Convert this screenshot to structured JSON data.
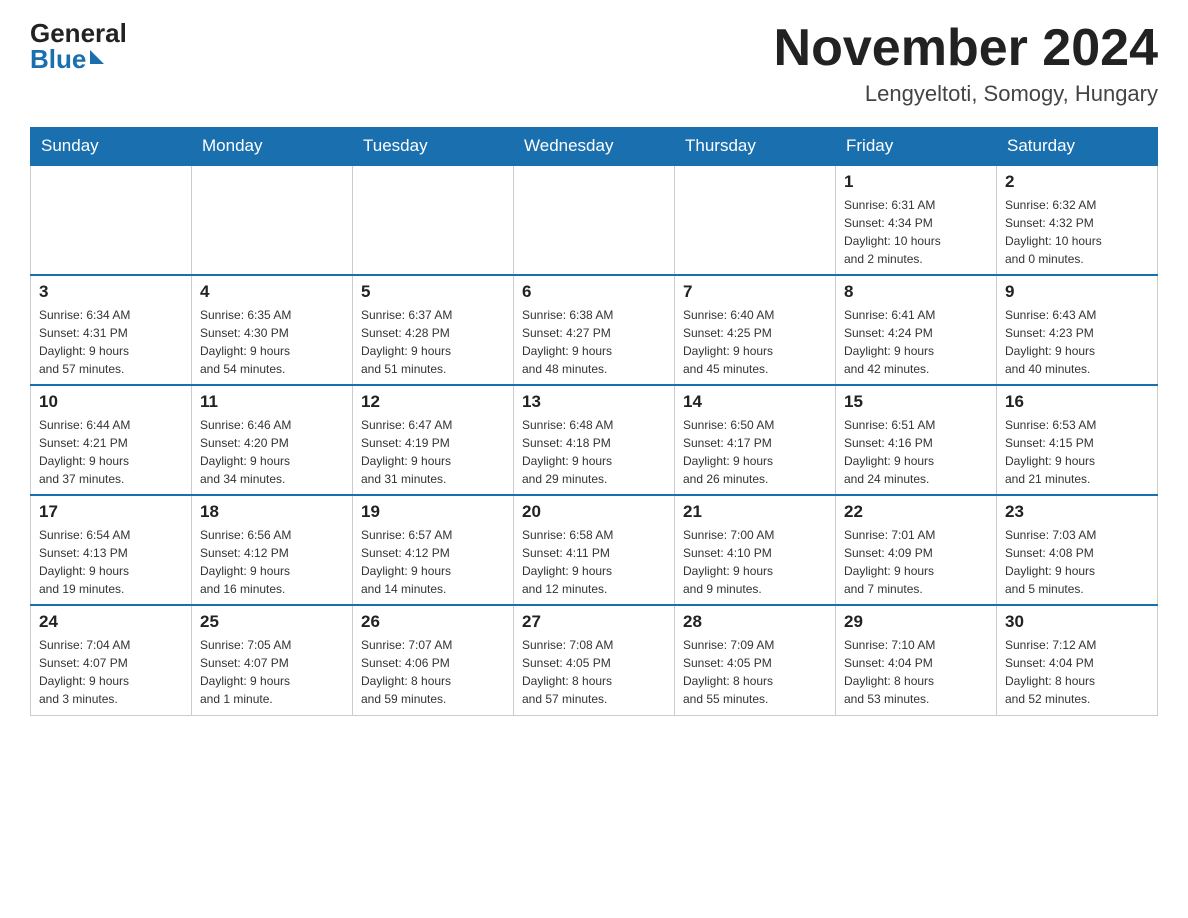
{
  "header": {
    "logo_general": "General",
    "logo_blue": "Blue",
    "month_title": "November 2024",
    "location": "Lengyeltoti, Somogy, Hungary"
  },
  "weekdays": [
    "Sunday",
    "Monday",
    "Tuesday",
    "Wednesday",
    "Thursday",
    "Friday",
    "Saturday"
  ],
  "weeks": [
    [
      {
        "day": "",
        "info": ""
      },
      {
        "day": "",
        "info": ""
      },
      {
        "day": "",
        "info": ""
      },
      {
        "day": "",
        "info": ""
      },
      {
        "day": "",
        "info": ""
      },
      {
        "day": "1",
        "info": "Sunrise: 6:31 AM\nSunset: 4:34 PM\nDaylight: 10 hours\nand 2 minutes."
      },
      {
        "day": "2",
        "info": "Sunrise: 6:32 AM\nSunset: 4:32 PM\nDaylight: 10 hours\nand 0 minutes."
      }
    ],
    [
      {
        "day": "3",
        "info": "Sunrise: 6:34 AM\nSunset: 4:31 PM\nDaylight: 9 hours\nand 57 minutes."
      },
      {
        "day": "4",
        "info": "Sunrise: 6:35 AM\nSunset: 4:30 PM\nDaylight: 9 hours\nand 54 minutes."
      },
      {
        "day": "5",
        "info": "Sunrise: 6:37 AM\nSunset: 4:28 PM\nDaylight: 9 hours\nand 51 minutes."
      },
      {
        "day": "6",
        "info": "Sunrise: 6:38 AM\nSunset: 4:27 PM\nDaylight: 9 hours\nand 48 minutes."
      },
      {
        "day": "7",
        "info": "Sunrise: 6:40 AM\nSunset: 4:25 PM\nDaylight: 9 hours\nand 45 minutes."
      },
      {
        "day": "8",
        "info": "Sunrise: 6:41 AM\nSunset: 4:24 PM\nDaylight: 9 hours\nand 42 minutes."
      },
      {
        "day": "9",
        "info": "Sunrise: 6:43 AM\nSunset: 4:23 PM\nDaylight: 9 hours\nand 40 minutes."
      }
    ],
    [
      {
        "day": "10",
        "info": "Sunrise: 6:44 AM\nSunset: 4:21 PM\nDaylight: 9 hours\nand 37 minutes."
      },
      {
        "day": "11",
        "info": "Sunrise: 6:46 AM\nSunset: 4:20 PM\nDaylight: 9 hours\nand 34 minutes."
      },
      {
        "day": "12",
        "info": "Sunrise: 6:47 AM\nSunset: 4:19 PM\nDaylight: 9 hours\nand 31 minutes."
      },
      {
        "day": "13",
        "info": "Sunrise: 6:48 AM\nSunset: 4:18 PM\nDaylight: 9 hours\nand 29 minutes."
      },
      {
        "day": "14",
        "info": "Sunrise: 6:50 AM\nSunset: 4:17 PM\nDaylight: 9 hours\nand 26 minutes."
      },
      {
        "day": "15",
        "info": "Sunrise: 6:51 AM\nSunset: 4:16 PM\nDaylight: 9 hours\nand 24 minutes."
      },
      {
        "day": "16",
        "info": "Sunrise: 6:53 AM\nSunset: 4:15 PM\nDaylight: 9 hours\nand 21 minutes."
      }
    ],
    [
      {
        "day": "17",
        "info": "Sunrise: 6:54 AM\nSunset: 4:13 PM\nDaylight: 9 hours\nand 19 minutes."
      },
      {
        "day": "18",
        "info": "Sunrise: 6:56 AM\nSunset: 4:12 PM\nDaylight: 9 hours\nand 16 minutes."
      },
      {
        "day": "19",
        "info": "Sunrise: 6:57 AM\nSunset: 4:12 PM\nDaylight: 9 hours\nand 14 minutes."
      },
      {
        "day": "20",
        "info": "Sunrise: 6:58 AM\nSunset: 4:11 PM\nDaylight: 9 hours\nand 12 minutes."
      },
      {
        "day": "21",
        "info": "Sunrise: 7:00 AM\nSunset: 4:10 PM\nDaylight: 9 hours\nand 9 minutes."
      },
      {
        "day": "22",
        "info": "Sunrise: 7:01 AM\nSunset: 4:09 PM\nDaylight: 9 hours\nand 7 minutes."
      },
      {
        "day": "23",
        "info": "Sunrise: 7:03 AM\nSunset: 4:08 PM\nDaylight: 9 hours\nand 5 minutes."
      }
    ],
    [
      {
        "day": "24",
        "info": "Sunrise: 7:04 AM\nSunset: 4:07 PM\nDaylight: 9 hours\nand 3 minutes."
      },
      {
        "day": "25",
        "info": "Sunrise: 7:05 AM\nSunset: 4:07 PM\nDaylight: 9 hours\nand 1 minute."
      },
      {
        "day": "26",
        "info": "Sunrise: 7:07 AM\nSunset: 4:06 PM\nDaylight: 8 hours\nand 59 minutes."
      },
      {
        "day": "27",
        "info": "Sunrise: 7:08 AM\nSunset: 4:05 PM\nDaylight: 8 hours\nand 57 minutes."
      },
      {
        "day": "28",
        "info": "Sunrise: 7:09 AM\nSunset: 4:05 PM\nDaylight: 8 hours\nand 55 minutes."
      },
      {
        "day": "29",
        "info": "Sunrise: 7:10 AM\nSunset: 4:04 PM\nDaylight: 8 hours\nand 53 minutes."
      },
      {
        "day": "30",
        "info": "Sunrise: 7:12 AM\nSunset: 4:04 PM\nDaylight: 8 hours\nand 52 minutes."
      }
    ]
  ]
}
